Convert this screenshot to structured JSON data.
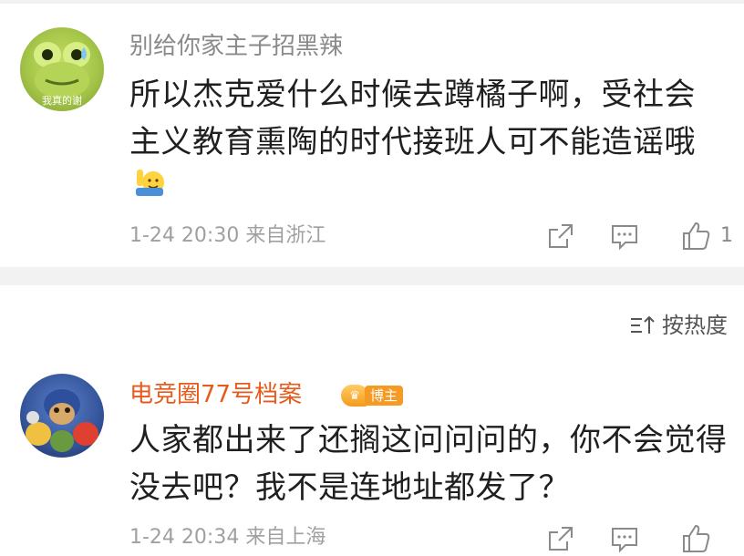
{
  "comments": [
    {
      "username": "别给你家主子招黑辣",
      "avatar_text": "我真的谢",
      "lines": [
        "所以杰克爱什么时候去蹲橘子啊，受社会",
        "主义教育熏陶的时代接班人可不能造谣哦"
      ],
      "emoji": "raised-hand-emoji",
      "meta": "1-24 20:30 来自浙江",
      "like_count": "1"
    },
    {
      "username": "电竞圈77号档案",
      "badge": "博主",
      "lines": [
        "人家都出来了还搁这问问问的，你不会觉得",
        "没去吧？我不是连地址都发了？"
      ],
      "meta": "1-24 20:34 来自上海",
      "like_count": ""
    }
  ],
  "sort": {
    "label": "按热度",
    "icon": "sort-icon"
  },
  "icons": {
    "share": "share-icon",
    "reply": "comment-icon",
    "like": "thumbs-up-icon"
  },
  "colors": {
    "username_default": "#8a8a8a",
    "username_blogger": "#e85a1c",
    "badge": "#f59a23",
    "meta": "#a0a0a0"
  }
}
